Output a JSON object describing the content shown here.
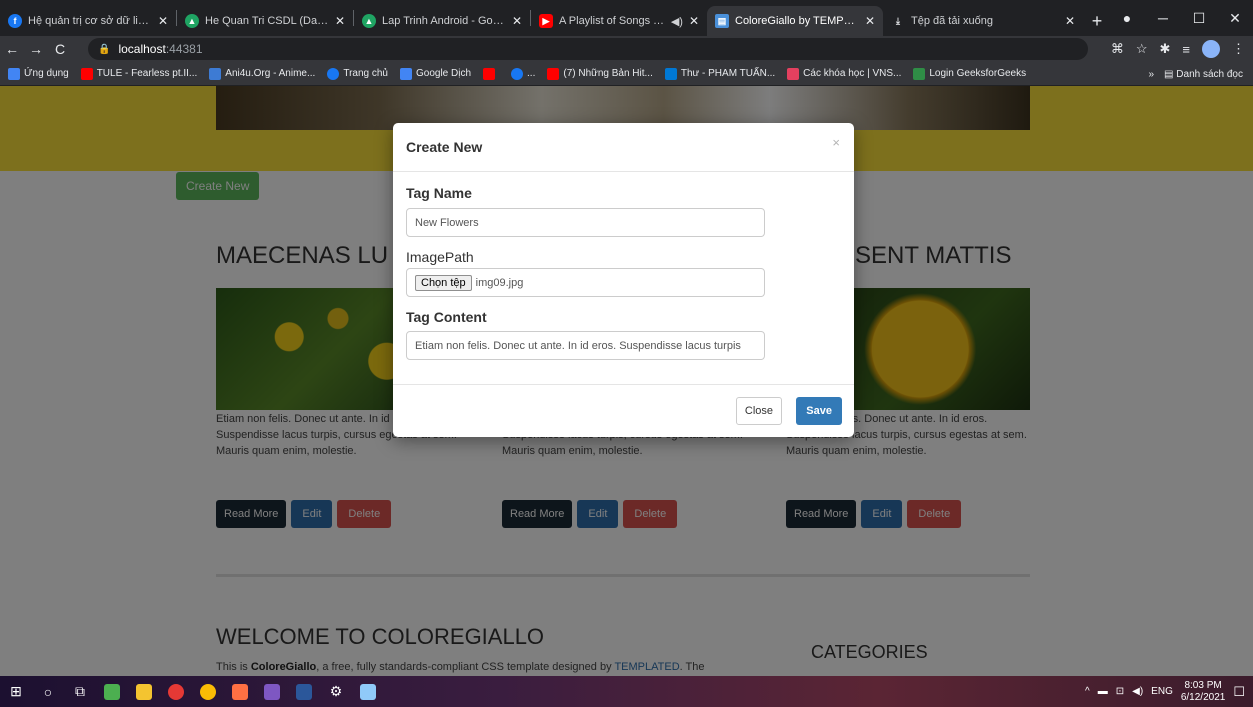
{
  "browser": {
    "tabs": [
      {
        "title": "Hệ quản trị cơ sở dữ liệu 20",
        "icon_color": "#1877f2",
        "icon": "facebook-icon",
        "active": false
      },
      {
        "title": "He Quan Tri CSDL (Databas",
        "icon_color": "#1fa463",
        "icon": "google-drive-icon",
        "active": false
      },
      {
        "title": "Lap Trinh Android - Google",
        "icon_color": "#1fa463",
        "icon": "google-drive-icon",
        "active": false
      },
      {
        "title": "A Playlist of Songs To S",
        "icon_color": "#ff0000",
        "icon": "youtube-icon",
        "active": false
      },
      {
        "title": "ColoreGiallo by TEMPLATED",
        "icon_color": "#4a90d9",
        "icon": "page-icon",
        "active": true
      },
      {
        "title": "Tệp đã tải xuống",
        "icon_color": "#e8eaed",
        "icon": "download-icon",
        "active": false
      }
    ],
    "address": {
      "host": "localhost",
      "port": ":44381"
    },
    "bookmarks": [
      {
        "label": "Ứng dụng",
        "color": "#4285f4"
      },
      {
        "label": "TULE - Fearless pt.II...",
        "color": "#ff0000"
      },
      {
        "label": "Ani4u.Org - Anime...",
        "color": "#3d7bd4"
      },
      {
        "label": "Trang chủ",
        "color": "#1877f2"
      },
      {
        "label": "Google Dịch",
        "color": "#4285f4"
      },
      {
        "label": "",
        "color": "#ff0000"
      },
      {
        "label": "...",
        "color": "#1877f2"
      },
      {
        "label": "(7) Những Bản Hit...",
        "color": "#ff0000"
      },
      {
        "label": "Thư - PHAM TUẤN...",
        "color": "#0078d4"
      },
      {
        "label": "Các khóa học | VNS...",
        "color": "#e4405f"
      },
      {
        "label": "Login GeeksforGeeks",
        "color": "#2f8d46"
      }
    ],
    "reading_list": "Danh sách đọc"
  },
  "page": {
    "create_new_label": "Create New",
    "posts": [
      {
        "title": "MAECENAS LU",
        "text": "Etiam non felis. Donec ut ante. In id eros. Suspendisse lacus turpis, cursus egestas at sem. Mauris quam enim, molestie."
      },
      {
        "title": "",
        "text": "Etiam non felis. Donec ut ante. In id eros. Suspendisse lacus turpis, cursus egestas at sem. Mauris quam enim, molestie."
      },
      {
        "title": "SENT MATTIS",
        "text": "Etiam non felis. Donec ut ante. In id eros. Suspendisse lacus turpis, cursus egestas at sem. Mauris quam enim, molestie."
      }
    ],
    "read_more_label": "Read More",
    "edit_label": "Edit",
    "delete_label": "Delete",
    "welcome_title": "WELCOME TO COLOREGIALLO",
    "welcome_pre": "This is ",
    "welcome_brand": "ColoreGiallo",
    "welcome_mid": ", a free, fully standards-compliant CSS template designed by ",
    "welcome_link": "TEMPLATED",
    "welcome_post": ". The",
    "categories_title": "CATEGORIES"
  },
  "modal": {
    "title": "Create New",
    "close_symbol": "×",
    "tag_name_label": "Tag Name",
    "tag_name_value": "New Flowers",
    "image_path_label": "ImagePath",
    "file_button_label": "Chọn tệp",
    "file_name": "img09.jpg",
    "tag_content_label": "Tag Content",
    "tag_content_value": "Etiam non felis. Donec ut ante. In id eros. Suspendisse lacus turpis",
    "close_label": "Close",
    "save_label": "Save"
  },
  "taskbar": {
    "language": "ENG",
    "time": "8:03 PM",
    "date": "6/12/2021"
  }
}
